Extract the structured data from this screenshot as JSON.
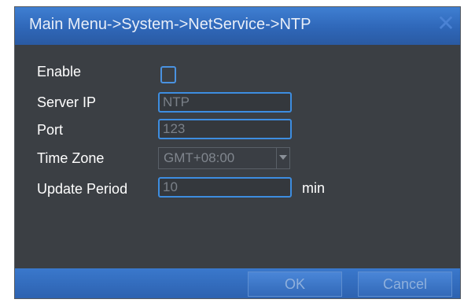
{
  "window": {
    "title": "Main Menu->System->NetService->NTP",
    "close_glyph": "✕"
  },
  "form": {
    "enable": {
      "label": "Enable",
      "checked": false
    },
    "server_ip": {
      "label": "Server IP",
      "value": "NTP"
    },
    "port": {
      "label": "Port",
      "value": "123"
    },
    "time_zone": {
      "label": "Time Zone",
      "value": "GMT+08:00"
    },
    "update_period": {
      "label": "Update Period",
      "value": "10",
      "unit": "min"
    }
  },
  "footer": {
    "ok_label": "OK",
    "cancel_label": "Cancel"
  },
  "colors": {
    "accent": "#2f67b8",
    "panel": "#3b3f44",
    "field_border": "#3d8de0"
  }
}
